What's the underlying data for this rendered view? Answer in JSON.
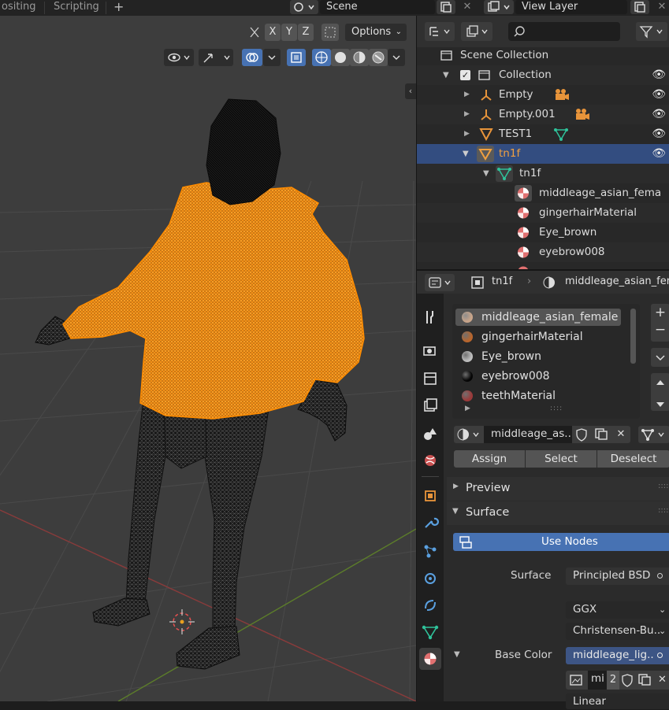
{
  "topbar": {
    "tabs": [
      "ositing",
      "Scripting"
    ],
    "add_tab": "+",
    "scene_label": "Scene",
    "view_layer_label": "View Layer"
  },
  "viewport": {
    "axes": [
      "X",
      "Y",
      "Z"
    ],
    "options_label": "Options"
  },
  "outliner": {
    "search_placeholder": "",
    "rows": [
      {
        "label": "Scene Collection"
      },
      {
        "label": "Collection"
      },
      {
        "label": "Empty"
      },
      {
        "label": "Empty.001"
      },
      {
        "label": "TEST1"
      },
      {
        "label": "tn1f"
      },
      {
        "label": "tn1f"
      },
      {
        "label": "middleage_asian_fema"
      },
      {
        "label": "gingerhairMaterial"
      },
      {
        "label": "Eye_brown"
      },
      {
        "label": "eyebrow008"
      }
    ]
  },
  "properties": {
    "breadcrumb_object": "tn1f",
    "breadcrumb_material": "middleage_asian_fen",
    "material_slots": [
      {
        "name": "middleage_asian_female",
        "color": "#c9a58a"
      },
      {
        "name": "gingerhairMaterial",
        "color": "#b8652c"
      },
      {
        "name": "Eye_brown",
        "color": "#bdbdbd"
      },
      {
        "name": "eyebrow008",
        "color": "#050505"
      },
      {
        "name": "teethMaterial",
        "color": "#9b3a3a"
      }
    ],
    "material_name": "middleage_as..",
    "assign_label": "Assign",
    "select_label": "Select",
    "deselect_label": "Deselect",
    "preview_label": "Preview",
    "surface_label": "Surface",
    "use_nodes_label": "Use Nodes",
    "surface_field_label": "Surface",
    "surface_value": "Principled BSD",
    "distribution_value": "GGX",
    "subsurface_value": "Christensen-Bu..",
    "base_color_label": "Base Color",
    "base_color_value": "middleage_lig..",
    "image_name": "mi",
    "image_users": "2",
    "interpolation_value": "Linear"
  },
  "colors": {
    "accent_blue": "#4772b3",
    "selection_blue": "#334d80",
    "wire_orange": "#ff8c00"
  }
}
